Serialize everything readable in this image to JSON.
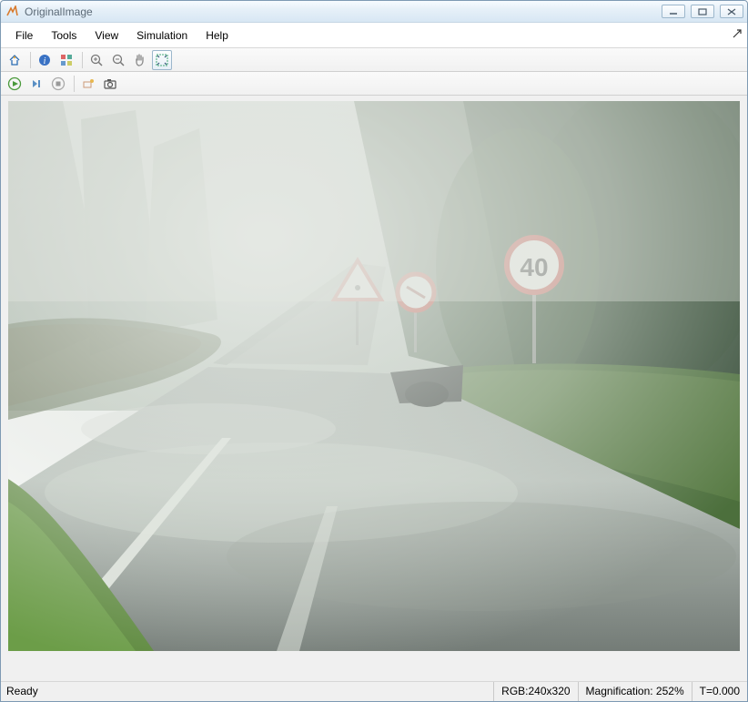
{
  "window": {
    "title": "OriginalImage"
  },
  "menu": {
    "file": "File",
    "tools": "Tools",
    "view": "View",
    "simulation": "Simulation",
    "help": "Help"
  },
  "icons": {
    "home": "home-icon",
    "info": "info-icon",
    "palette": "palette-icon",
    "zoomin": "zoom-in-icon",
    "zoomout": "zoom-out-icon",
    "pan": "pan-icon",
    "fit": "fit-to-view-icon",
    "run": "run-icon",
    "step": "step-forward-icon",
    "stop": "stop-icon",
    "highlight": "highlight-icon",
    "snapshot": "snapshot-icon"
  },
  "image": {
    "road_sign_speed": "40"
  },
  "status": {
    "ready": "Ready",
    "rgb": "RGB:240x320",
    "mag": "Magnification: 252%",
    "time": "T=0.000"
  }
}
